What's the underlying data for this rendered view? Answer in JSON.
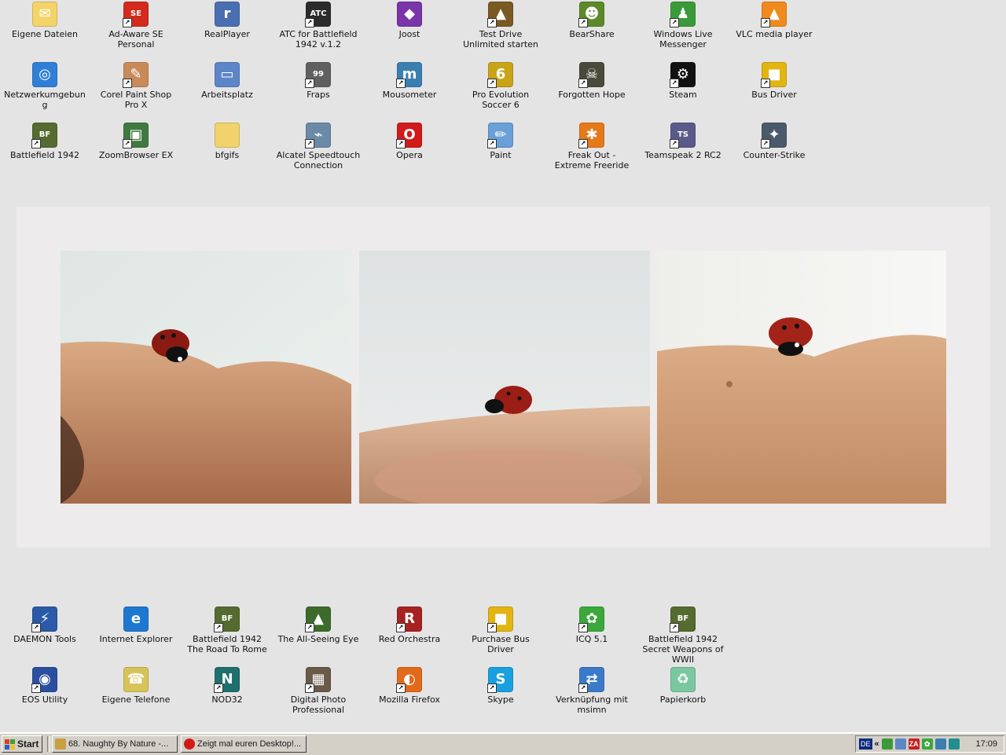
{
  "desktop_icons_top": [
    {
      "label": "Eigene Dateien",
      "icon": "folder-documents-icon",
      "color": "#f4d469",
      "glyph": "✉",
      "shortcut": false
    },
    {
      "label": "Ad-Aware SE Personal",
      "icon": "adaware-icon",
      "color": "#d22a1d",
      "glyph": "SE",
      "shortcut": true
    },
    {
      "label": "RealPlayer",
      "icon": "realplayer-icon",
      "color": "#4a6fb0",
      "glyph": "r",
      "shortcut": false
    },
    {
      "label": "ATC for Battlefield 1942 v.1.2",
      "icon": "atc-icon",
      "color": "#2b2b2b",
      "glyph": "ATC",
      "shortcut": true
    },
    {
      "label": "Joost",
      "icon": "joost-icon",
      "color": "#7a35a8",
      "glyph": "◆",
      "shortcut": false
    },
    {
      "label": "Test Drive Unlimited starten",
      "icon": "test-drive-icon",
      "color": "#7a5a22",
      "glyph": "▲",
      "shortcut": true
    },
    {
      "label": "BearShare",
      "icon": "bearshare-icon",
      "color": "#5c8a2a",
      "glyph": "☻",
      "shortcut": true
    },
    {
      "label": "Windows Live Messenger",
      "icon": "messenger-icon",
      "color": "#3a9a3a",
      "glyph": "♟",
      "shortcut": true
    },
    {
      "label": "VLC media player",
      "icon": "vlc-icon",
      "color": "#f18a1c",
      "glyph": "▲",
      "shortcut": true
    },
    {
      "label": "Netzwerkumgebung",
      "icon": "network-icon",
      "color": "#2f7fd6",
      "glyph": "◎",
      "shortcut": false
    },
    {
      "label": "Corel Paint Shop Pro X",
      "icon": "paintshop-icon",
      "color": "#c98a5a",
      "glyph": "✎",
      "shortcut": true
    },
    {
      "label": "Arbeitsplatz",
      "icon": "computer-icon",
      "color": "#5d86c8",
      "glyph": "▭",
      "shortcut": false
    },
    {
      "label": "Fraps",
      "icon": "fraps-icon",
      "color": "#606060",
      "glyph": "99",
      "shortcut": true
    },
    {
      "label": "Mousometer",
      "icon": "mousometer-icon",
      "color": "#3a7fb0",
      "glyph": "m",
      "shortcut": true
    },
    {
      "label": "Pro Evolution Soccer 6",
      "icon": "pes-icon",
      "color": "#c9a418",
      "glyph": "6",
      "shortcut": true
    },
    {
      "label": "Forgotten Hope",
      "icon": "forgotten-hope-icon",
      "color": "#4a4a3a",
      "glyph": "☠",
      "shortcut": true
    },
    {
      "label": "Steam",
      "icon": "steam-icon",
      "color": "#111111",
      "glyph": "⚙",
      "shortcut": true
    },
    {
      "label": "Bus Driver",
      "icon": "bus-driver-icon",
      "color": "#e2b511",
      "glyph": "■",
      "shortcut": true
    },
    {
      "label": "Battlefield 1942",
      "icon": "battlefield-icon",
      "color": "#556b2f",
      "glyph": "BF",
      "shortcut": true
    },
    {
      "label": "ZoomBrowser EX",
      "icon": "zoombrowser-icon",
      "color": "#3f7a3f",
      "glyph": "▣",
      "shortcut": true
    },
    {
      "label": "bfgifs",
      "icon": "folder-icon",
      "color": "#f2d26a",
      "glyph": "",
      "shortcut": false
    },
    {
      "label": "Alcatel Speedtouch Connection",
      "icon": "alcatel-icon",
      "color": "#6a8aa8",
      "glyph": "⌁",
      "shortcut": true
    },
    {
      "label": "Opera",
      "icon": "opera-icon",
      "color": "#d21a1a",
      "glyph": "O",
      "shortcut": true
    },
    {
      "label": "Paint",
      "icon": "paint-icon",
      "color": "#6aa0d8",
      "glyph": "✏",
      "shortcut": true
    },
    {
      "label": "Freak Out - Extreme Freeride",
      "icon": "freak-out-icon",
      "color": "#e57a1a",
      "glyph": "✱",
      "shortcut": true
    },
    {
      "label": "Teamspeak 2 RC2",
      "icon": "teamspeak-icon",
      "color": "#5a5a8a",
      "glyph": "TS",
      "shortcut": true
    },
    {
      "label": "Counter-Strike",
      "icon": "counter-strike-icon",
      "color": "#4a5a6a",
      "glyph": "✦",
      "shortcut": true
    }
  ],
  "desktop_icons_bottom": [
    {
      "label": "DAEMON Tools",
      "icon": "daemon-tools-icon",
      "color": "#2a5aa8",
      "glyph": "⚡",
      "shortcut": true
    },
    {
      "label": "Internet Explorer",
      "icon": "internet-explorer-icon",
      "color": "#1e78d2",
      "glyph": "e",
      "shortcut": false
    },
    {
      "label": "Battlefield 1942 The Road To Rome",
      "icon": "battlefield-rtr-icon",
      "color": "#556b2f",
      "glyph": "BF",
      "shortcut": true
    },
    {
      "label": "The All-Seeing Eye",
      "icon": "all-seeing-eye-icon",
      "color": "#3d6b2b",
      "glyph": "▲",
      "shortcut": true
    },
    {
      "label": "Red Orchestra",
      "icon": "red-orchestra-icon",
      "color": "#a82222",
      "glyph": "R",
      "shortcut": true
    },
    {
      "label": "Purchase Bus Driver",
      "icon": "purchase-bus-driver-icon",
      "color": "#e2b511",
      "glyph": "■",
      "shortcut": true
    },
    {
      "label": "ICQ 5.1",
      "icon": "icq-icon",
      "color": "#3aa83a",
      "glyph": "✿",
      "shortcut": true
    },
    {
      "label": "Battlefield 1942 Secret Weapons of WWII",
      "icon": "battlefield-sw-icon",
      "color": "#556b2f",
      "glyph": "BF",
      "shortcut": true
    },
    {
      "label": "EOS Utility",
      "icon": "eos-utility-icon",
      "color": "#2a4fa0",
      "glyph": "◉",
      "shortcut": true
    },
    {
      "label": "Eigene Telefone",
      "icon": "phone-icon",
      "color": "#d8c25a",
      "glyph": "☎",
      "shortcut": false
    },
    {
      "label": "NOD32",
      "icon": "nod32-icon",
      "color": "#1f6f6f",
      "glyph": "N",
      "shortcut": true
    },
    {
      "label": "Digital Photo Professional",
      "icon": "dpp-icon",
      "color": "#6a5a4a",
      "glyph": "▦",
      "shortcut": true
    },
    {
      "label": "Mozilla Firefox",
      "icon": "firefox-icon",
      "color": "#e26a1a",
      "glyph": "◐",
      "shortcut": true
    },
    {
      "label": "Skype",
      "icon": "skype-icon",
      "color": "#1aa0e0",
      "glyph": "S",
      "shortcut": true
    },
    {
      "label": "Verknüpfung mit msimn",
      "icon": "msimn-icon",
      "color": "#3a7ac8",
      "glyph": "⇄",
      "shortcut": true
    },
    {
      "label": "Papierkorb",
      "icon": "recycle-bin-icon",
      "color": "#7ac8a0",
      "glyph": "♻",
      "shortcut": false
    }
  ],
  "taskbar": {
    "start_label": "Start",
    "tasks": [
      {
        "label": "68. Naughty By Nature -...",
        "icon": "winamp-icon",
        "color": "#c8a040"
      },
      {
        "label": "Zeigt mal euren Desktop!...",
        "icon": "opera-icon",
        "color": "#d21a1a"
      }
    ],
    "language": "DE",
    "tray_chevron": "«",
    "clock": "17:09"
  }
}
